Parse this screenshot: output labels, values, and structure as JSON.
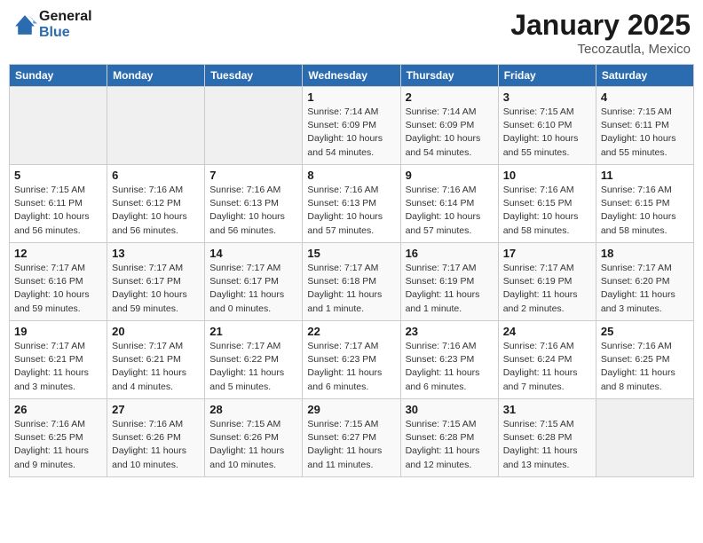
{
  "header": {
    "logo_line1": "General",
    "logo_line2": "Blue",
    "month": "January 2025",
    "location": "Tecozautla, Mexico"
  },
  "weekdays": [
    "Sunday",
    "Monday",
    "Tuesday",
    "Wednesday",
    "Thursday",
    "Friday",
    "Saturday"
  ],
  "weeks": [
    [
      {
        "day": "",
        "info": ""
      },
      {
        "day": "",
        "info": ""
      },
      {
        "day": "",
        "info": ""
      },
      {
        "day": "1",
        "info": "Sunrise: 7:14 AM\nSunset: 6:09 PM\nDaylight: 10 hours\nand 54 minutes."
      },
      {
        "day": "2",
        "info": "Sunrise: 7:14 AM\nSunset: 6:09 PM\nDaylight: 10 hours\nand 54 minutes."
      },
      {
        "day": "3",
        "info": "Sunrise: 7:15 AM\nSunset: 6:10 PM\nDaylight: 10 hours\nand 55 minutes."
      },
      {
        "day": "4",
        "info": "Sunrise: 7:15 AM\nSunset: 6:11 PM\nDaylight: 10 hours\nand 55 minutes."
      }
    ],
    [
      {
        "day": "5",
        "info": "Sunrise: 7:15 AM\nSunset: 6:11 PM\nDaylight: 10 hours\nand 56 minutes."
      },
      {
        "day": "6",
        "info": "Sunrise: 7:16 AM\nSunset: 6:12 PM\nDaylight: 10 hours\nand 56 minutes."
      },
      {
        "day": "7",
        "info": "Sunrise: 7:16 AM\nSunset: 6:13 PM\nDaylight: 10 hours\nand 56 minutes."
      },
      {
        "day": "8",
        "info": "Sunrise: 7:16 AM\nSunset: 6:13 PM\nDaylight: 10 hours\nand 57 minutes."
      },
      {
        "day": "9",
        "info": "Sunrise: 7:16 AM\nSunset: 6:14 PM\nDaylight: 10 hours\nand 57 minutes."
      },
      {
        "day": "10",
        "info": "Sunrise: 7:16 AM\nSunset: 6:15 PM\nDaylight: 10 hours\nand 58 minutes."
      },
      {
        "day": "11",
        "info": "Sunrise: 7:16 AM\nSunset: 6:15 PM\nDaylight: 10 hours\nand 58 minutes."
      }
    ],
    [
      {
        "day": "12",
        "info": "Sunrise: 7:17 AM\nSunset: 6:16 PM\nDaylight: 10 hours\nand 59 minutes."
      },
      {
        "day": "13",
        "info": "Sunrise: 7:17 AM\nSunset: 6:17 PM\nDaylight: 10 hours\nand 59 minutes."
      },
      {
        "day": "14",
        "info": "Sunrise: 7:17 AM\nSunset: 6:17 PM\nDaylight: 11 hours\nand 0 minutes."
      },
      {
        "day": "15",
        "info": "Sunrise: 7:17 AM\nSunset: 6:18 PM\nDaylight: 11 hours\nand 1 minute."
      },
      {
        "day": "16",
        "info": "Sunrise: 7:17 AM\nSunset: 6:19 PM\nDaylight: 11 hours\nand 1 minute."
      },
      {
        "day": "17",
        "info": "Sunrise: 7:17 AM\nSunset: 6:19 PM\nDaylight: 11 hours\nand 2 minutes."
      },
      {
        "day": "18",
        "info": "Sunrise: 7:17 AM\nSunset: 6:20 PM\nDaylight: 11 hours\nand 3 minutes."
      }
    ],
    [
      {
        "day": "19",
        "info": "Sunrise: 7:17 AM\nSunset: 6:21 PM\nDaylight: 11 hours\nand 3 minutes."
      },
      {
        "day": "20",
        "info": "Sunrise: 7:17 AM\nSunset: 6:21 PM\nDaylight: 11 hours\nand 4 minutes."
      },
      {
        "day": "21",
        "info": "Sunrise: 7:17 AM\nSunset: 6:22 PM\nDaylight: 11 hours\nand 5 minutes."
      },
      {
        "day": "22",
        "info": "Sunrise: 7:17 AM\nSunset: 6:23 PM\nDaylight: 11 hours\nand 6 minutes."
      },
      {
        "day": "23",
        "info": "Sunrise: 7:16 AM\nSunset: 6:23 PM\nDaylight: 11 hours\nand 6 minutes."
      },
      {
        "day": "24",
        "info": "Sunrise: 7:16 AM\nSunset: 6:24 PM\nDaylight: 11 hours\nand 7 minutes."
      },
      {
        "day": "25",
        "info": "Sunrise: 7:16 AM\nSunset: 6:25 PM\nDaylight: 11 hours\nand 8 minutes."
      }
    ],
    [
      {
        "day": "26",
        "info": "Sunrise: 7:16 AM\nSunset: 6:25 PM\nDaylight: 11 hours\nand 9 minutes."
      },
      {
        "day": "27",
        "info": "Sunrise: 7:16 AM\nSunset: 6:26 PM\nDaylight: 11 hours\nand 10 minutes."
      },
      {
        "day": "28",
        "info": "Sunrise: 7:15 AM\nSunset: 6:26 PM\nDaylight: 11 hours\nand 10 minutes."
      },
      {
        "day": "29",
        "info": "Sunrise: 7:15 AM\nSunset: 6:27 PM\nDaylight: 11 hours\nand 11 minutes."
      },
      {
        "day": "30",
        "info": "Sunrise: 7:15 AM\nSunset: 6:28 PM\nDaylight: 11 hours\nand 12 minutes."
      },
      {
        "day": "31",
        "info": "Sunrise: 7:15 AM\nSunset: 6:28 PM\nDaylight: 11 hours\nand 13 minutes."
      },
      {
        "day": "",
        "info": ""
      }
    ]
  ]
}
